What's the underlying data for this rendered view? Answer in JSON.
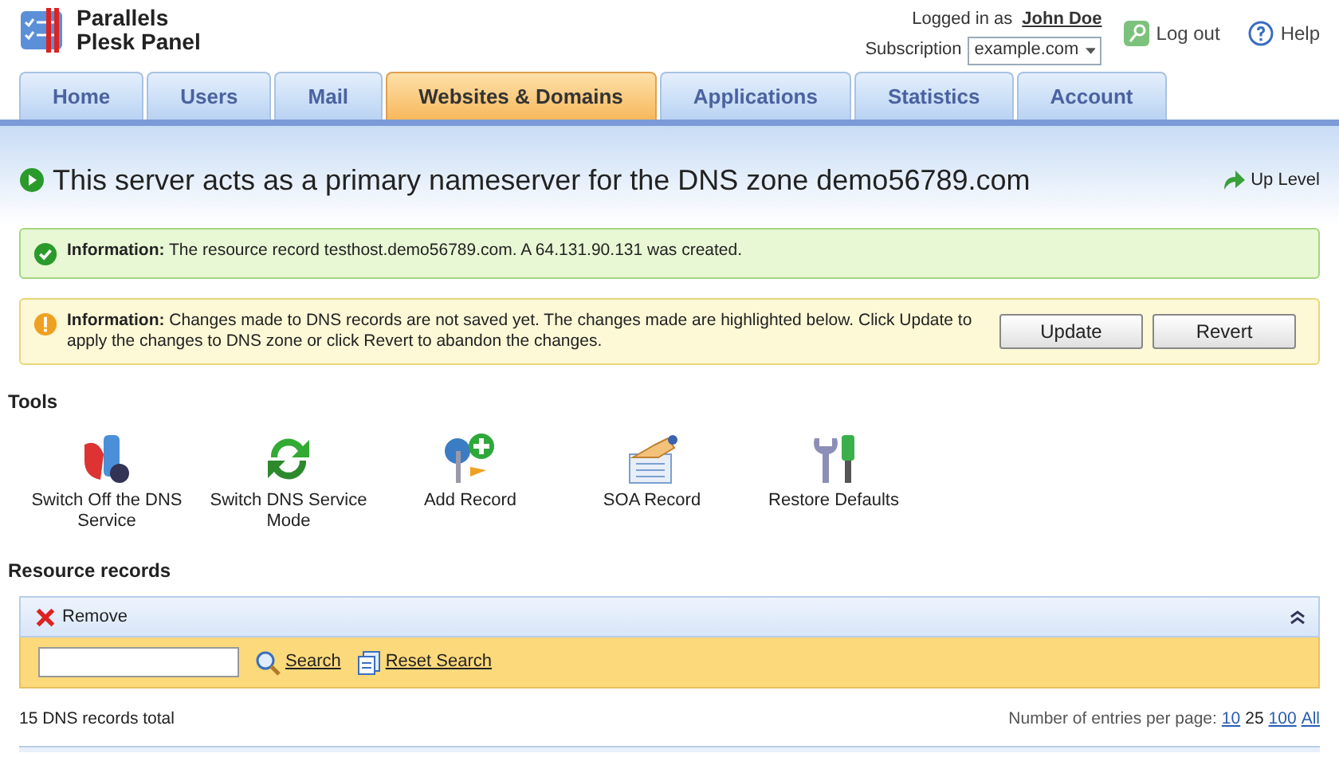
{
  "header": {
    "product_line1": "Parallels",
    "product_line2": "Plesk Panel",
    "logged_in_label": "Logged in as",
    "user_name": "John Doe",
    "subscription_label": "Subscription",
    "subscription_value": "example.com",
    "logout": "Log out",
    "help": "Help"
  },
  "tabs": [
    {
      "label": "Home",
      "selected": false
    },
    {
      "label": "Users",
      "selected": false
    },
    {
      "label": "Mail",
      "selected": false
    },
    {
      "label": "Websites & Domains",
      "selected": true
    },
    {
      "label": "Applications",
      "selected": false
    },
    {
      "label": "Statistics",
      "selected": false
    },
    {
      "label": "Account",
      "selected": false
    }
  ],
  "page_title": "This server acts as a primary nameserver for the DNS zone demo56789.com",
  "up_level": "Up Level",
  "messages": [
    {
      "kind": "success",
      "text": "**Information:** The resource record testhost.demo56789.com. A 64.131.90.131 was created."
    },
    {
      "kind": "warning",
      "text": "**Information:** Changes made to DNS records are not saved yet. The changes made are highlighted below. Click Update to apply the changes to DNS zone or click Revert to abandon the changes.",
      "buttons": [
        "Update",
        "Revert"
      ]
    }
  ],
  "tools": {
    "title": "Tools",
    "items": [
      {
        "kind": "switch-off",
        "label": "Switch Off the DNS Service"
      },
      {
        "kind": "switch-mode",
        "label": "Switch DNS Service Mode"
      },
      {
        "kind": "add",
        "label": "Add Record"
      },
      {
        "kind": "soa",
        "label": "SOA Record"
      },
      {
        "kind": "restore",
        "label": "Restore Defaults"
      }
    ]
  },
  "resource_records": {
    "title": "Resource records",
    "remove": "Remove",
    "search_button": "Search",
    "reset_search": "Reset Search",
    "total": "15 DNS records total",
    "per_page_label": "Number of entries per page:",
    "per_page_options": [
      {
        "label": "10",
        "selected": false
      },
      {
        "label": "25",
        "selected": true
      },
      {
        "label": "100",
        "selected": false
      },
      {
        "label": "All",
        "selected": false
      }
    ]
  }
}
